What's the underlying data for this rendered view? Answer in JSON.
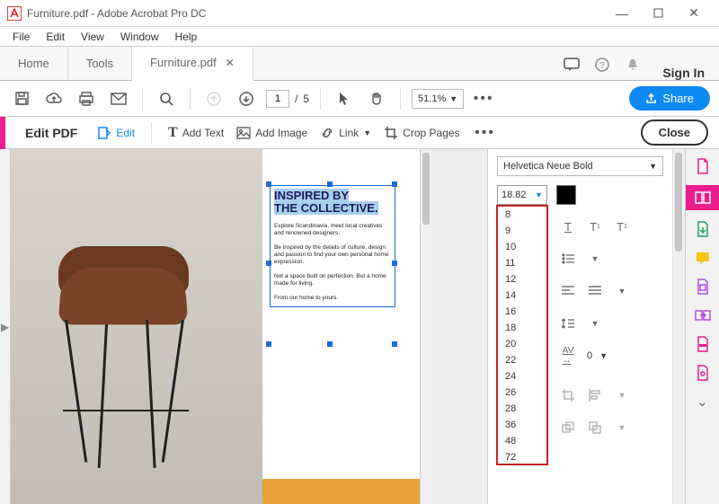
{
  "window": {
    "title": "Furniture.pdf - Adobe Acrobat Pro DC"
  },
  "menubar": [
    "File",
    "Edit",
    "View",
    "Window",
    "Help"
  ],
  "tabs": {
    "home": "Home",
    "tools": "Tools",
    "doc": "Furniture.pdf",
    "signin": "Sign In"
  },
  "toolbar": {
    "page_current": "1",
    "page_sep": "/",
    "page_total": "5",
    "zoom": "51.1%",
    "share": "Share"
  },
  "editbar": {
    "title": "Edit PDF",
    "edit": "Edit",
    "addtext": "Add Text",
    "addimage": "Add Image",
    "link": "Link",
    "crop": "Crop Pages",
    "close": "Close"
  },
  "doc": {
    "headline_l1": "INSPIRED BY",
    "headline_l2": "THE COLLECTIVE.",
    "p1": "Explore Scandinavia, meet local creatives and renowned designers.",
    "p2": "Be inspired by the details of culture, design and passion to find your own personal home expression.",
    "p3": "Not a space built on perfection. But a home made for living.",
    "p4": "From our home to yours."
  },
  "props": {
    "font": "Helvetica Neue Bold",
    "size": "18.82",
    "sizes": [
      "8",
      "9",
      "10",
      "11",
      "12",
      "14",
      "16",
      "18",
      "20",
      "22",
      "24",
      "26",
      "28",
      "36",
      "48",
      "72"
    ],
    "kern": "0"
  }
}
